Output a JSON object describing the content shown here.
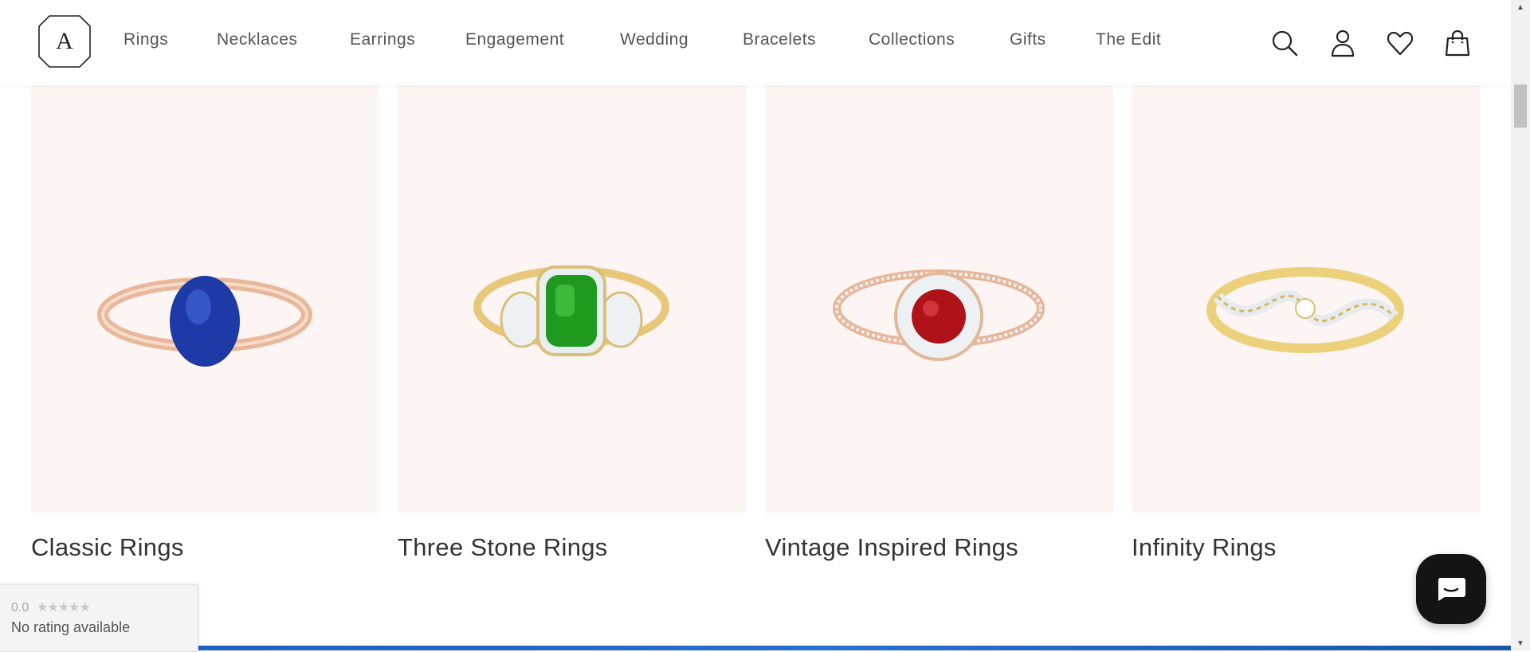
{
  "brand": {
    "logo_letter": "A"
  },
  "nav": {
    "items": [
      {
        "label": "Rings"
      },
      {
        "label": "Necklaces"
      },
      {
        "label": "Earrings"
      },
      {
        "label": "Engagement"
      },
      {
        "label": "Wedding"
      },
      {
        "label": "Bracelets"
      },
      {
        "label": "Collections"
      },
      {
        "label": "Gifts"
      },
      {
        "label": "The Edit"
      }
    ]
  },
  "header_icons": [
    "search-icon",
    "account-icon",
    "wishlist-heart-icon",
    "shopping-bag-icon"
  ],
  "products": [
    {
      "title": "Classic Rings",
      "gem_color": "#1d3aa6",
      "metal_color": "#e9b79a"
    },
    {
      "title": "Three Stone Rings",
      "gem_color": "#1f9a1f",
      "metal_color": "#e8c77a"
    },
    {
      "title": "Vintage Inspired Rings",
      "gem_color": "#b0121a",
      "metal_color": "#e7b597"
    },
    {
      "title": "Infinity Rings",
      "gem_color": "#ffffff",
      "metal_color": "#ecd17c"
    }
  ],
  "rating_widget": {
    "score": "0.0",
    "stars": "★★★★★",
    "text": "No rating available"
  },
  "colors": {
    "card_background": "#fdf4f4",
    "chat_button": "#141414",
    "bottom_strip": "#1f5fbf"
  }
}
